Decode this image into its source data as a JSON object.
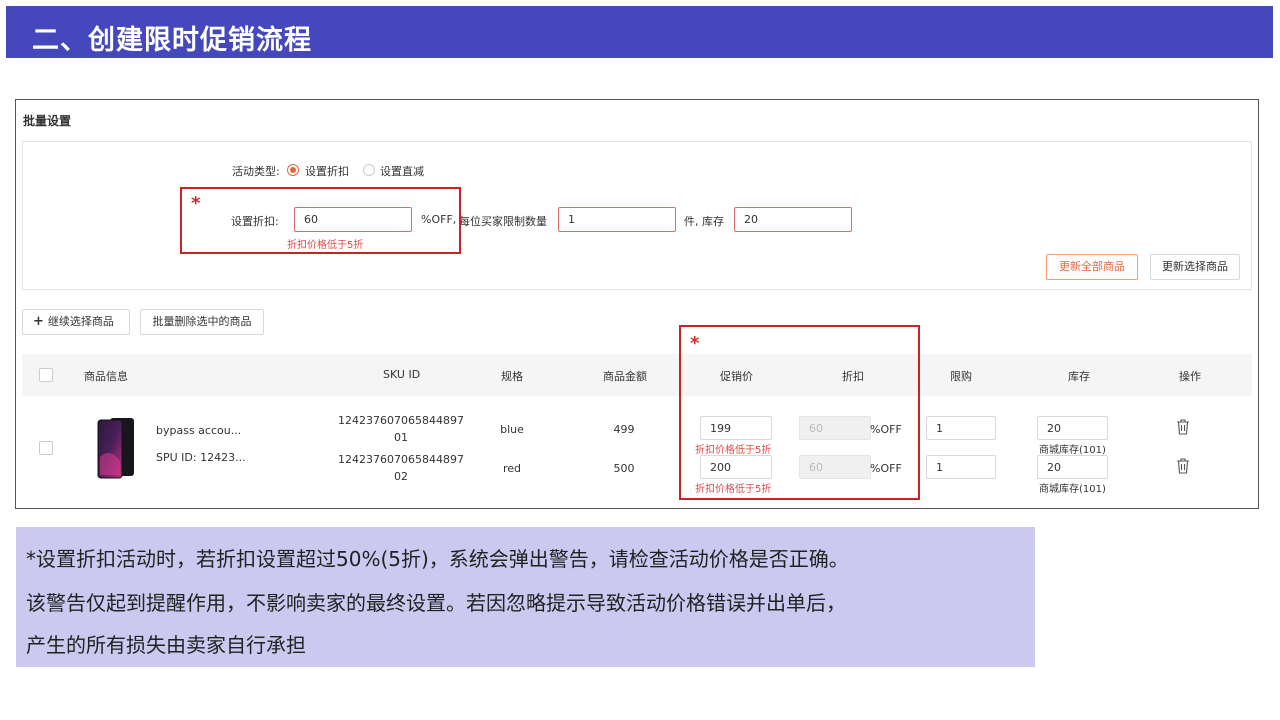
{
  "header": {
    "title": "二、创建限时促销流程"
  },
  "panel": {
    "title": "批量设置",
    "activity_type_label": "活动类型:",
    "radio_discount": "设置折扣",
    "radio_reduce": "设置直减",
    "discount_label": "设置折扣:",
    "discount_value": "60",
    "discount_unit": "%OFF,",
    "limit_label": "每位买家限制数量",
    "limit_value": "1",
    "stock_label": "件, 库存",
    "stock_value": "20",
    "discount_error": "折扣价格低于5折",
    "btn_update_all": "更新全部商品",
    "btn_update_selected": "更新选择商品",
    "btn_continue": "继续选择商品",
    "btn_batch_delete": "批量删除选中的商品",
    "star": "*"
  },
  "table": {
    "headers": {
      "product": "商品信息",
      "sku": "SKU ID",
      "spec": "规格",
      "amount": "商品金额",
      "promo_price": "促销价",
      "discount": "折扣",
      "limit": "限购",
      "stock": "库存",
      "action": "操作"
    },
    "product": {
      "name": "bypass accou...",
      "spu": "SPU ID: 12423..."
    },
    "rows": [
      {
        "sku_a": "124237607065844897",
        "sku_b": "01",
        "spec": "blue",
        "amount": "499",
        "promo": "199",
        "promo_error": "折扣价格低于5折",
        "discount": "60",
        "discount_unit": "%OFF",
        "limit": "1",
        "stock": "20",
        "stock_note": "商城库存(101)"
      },
      {
        "sku_a": "124237607065844897",
        "sku_b": "02",
        "spec": "red",
        "amount": "500",
        "promo": "200",
        "promo_error": "折扣价格低于5折",
        "discount": "60",
        "discount_unit": "%OFF",
        "limit": "1",
        "stock": "20",
        "stock_note": "商城库存(101)"
      }
    ]
  },
  "note": {
    "line1": "*设置折扣活动时，若折扣设置超过50%(5折)，系统会弹出警告，请检查活动价格是否正确。",
    "line2": "该警告仅起到提醒作用，不影响卖家的最终设置。若因忽略提示导致活动价格错误并出单后，",
    "line3": "产生的所有损失由卖家自行承担"
  },
  "colors": {
    "header_bg": "#4448bc",
    "accent_orange": "#e8663d",
    "error_red": "#e04b4b",
    "highlight_box": "#c82424",
    "note_bg": "#ccc9f0"
  }
}
